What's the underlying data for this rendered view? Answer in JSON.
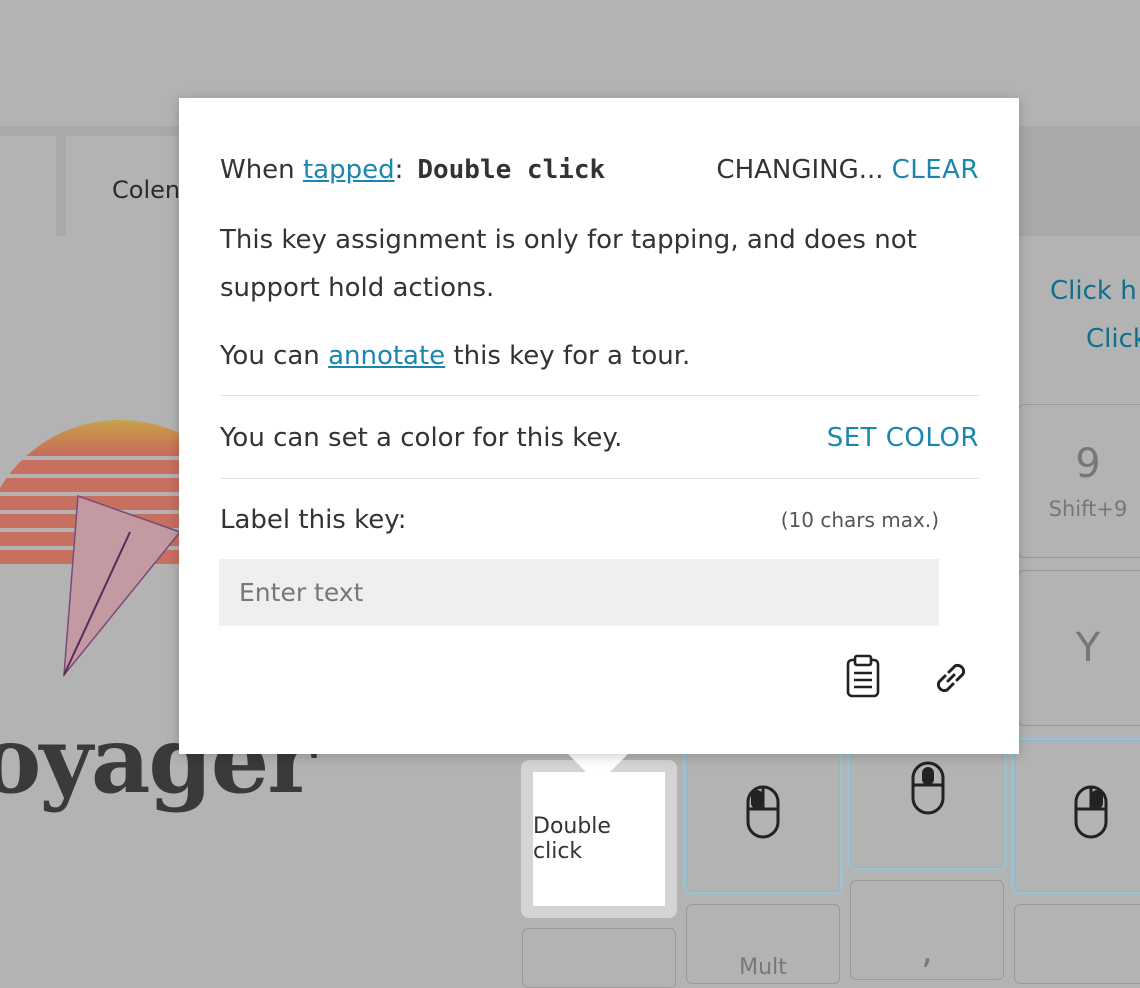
{
  "background": {
    "tab_label": "Colen",
    "links": [
      "Click h",
      "Click"
    ],
    "logo_text": "oyager",
    "keys": [
      {
        "main": "9",
        "sub": "Shift+9"
      },
      {
        "main": "Y"
      },
      {
        "main": ","
      },
      {
        "main": "Mult"
      }
    ],
    "selected_key_label": "Double click"
  },
  "popup": {
    "when_prefix": "When ",
    "tapped_link": "tapped",
    "colon": ":",
    "action_name": "Double click",
    "changing": "CHANGING...",
    "clear": "CLEAR",
    "tap_only_note": "This key assignment is only for tapping, and does not support hold actions.",
    "annotate_prefix": "You can ",
    "annotate_link": "annotate",
    "annotate_suffix": " this key for a tour.",
    "color_text": "You can set a color for this key.",
    "set_color": "SET COLOR",
    "label_heading": "Label this key:",
    "label_limit": "(10 chars max.)",
    "label_placeholder": "Enter text",
    "label_value": ""
  },
  "icons": {
    "clipboard": "clipboard-icon",
    "link": "link-icon",
    "mouse": "mouse-icon"
  },
  "colors": {
    "accent": "#1b87b0",
    "overlay": "#b3b3b3"
  }
}
